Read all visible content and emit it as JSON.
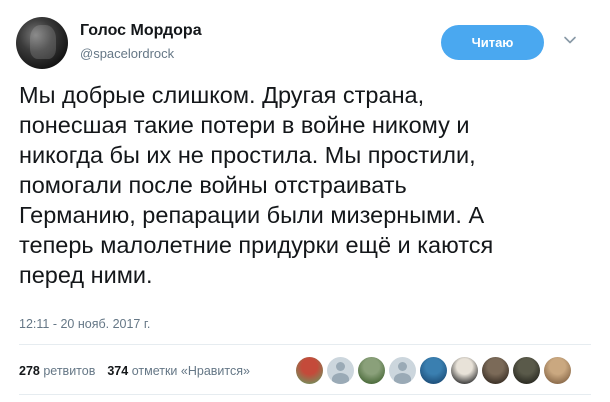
{
  "author": {
    "name": "Голос Мордора",
    "handle": "@spacelordrock",
    "avatar_icon": "profile-avatar"
  },
  "follow_button": {
    "label": "Читаю",
    "color": "#4aa8f0"
  },
  "more_icon": "chevron-down-icon",
  "tweet": {
    "text": "Мы добрые слишком. Другая страна,\nпонесшая такие потери в войне никому и\nникогда бы их не простила. Мы простили,\nпомогали после войны отстраивать\nГерманию, репарации были мизерными. А\nтеперь малолетние придурки ещё и каются\nперед ними.",
    "timestamp": "12:11 - 20 нояб. 2017 г."
  },
  "stats": {
    "retweets_count": "278",
    "retweets_label": "ретвитов",
    "likes_count": "374",
    "likes_label": "отметки «Нравится»"
  },
  "likers": [
    {
      "name": "liker-avatar-1",
      "colors": [
        "#c44a3a",
        "#7a8a5a"
      ]
    },
    {
      "name": "liker-avatar-2",
      "colors": [
        "#ccd6dd",
        "#9aaab6"
      ]
    },
    {
      "name": "liker-avatar-3",
      "colors": [
        "#8aa07a",
        "#4a6a3a"
      ]
    },
    {
      "name": "liker-avatar-4",
      "colors": [
        "#ccd6dd",
        "#9aaab6"
      ]
    },
    {
      "name": "liker-avatar-5",
      "colors": [
        "#3a7fb0",
        "#1d4f7a"
      ]
    },
    {
      "name": "liker-avatar-6",
      "colors": [
        "#e8e2d8",
        "#3a3a3a"
      ]
    },
    {
      "name": "liker-avatar-7",
      "colors": [
        "#7b6a58",
        "#3a2f25"
      ]
    },
    {
      "name": "liker-avatar-8",
      "colors": [
        "#5a5a4a",
        "#2a2a22"
      ]
    },
    {
      "name": "liker-avatar-9",
      "colors": [
        "#caa880",
        "#8a6a4a"
      ]
    }
  ]
}
